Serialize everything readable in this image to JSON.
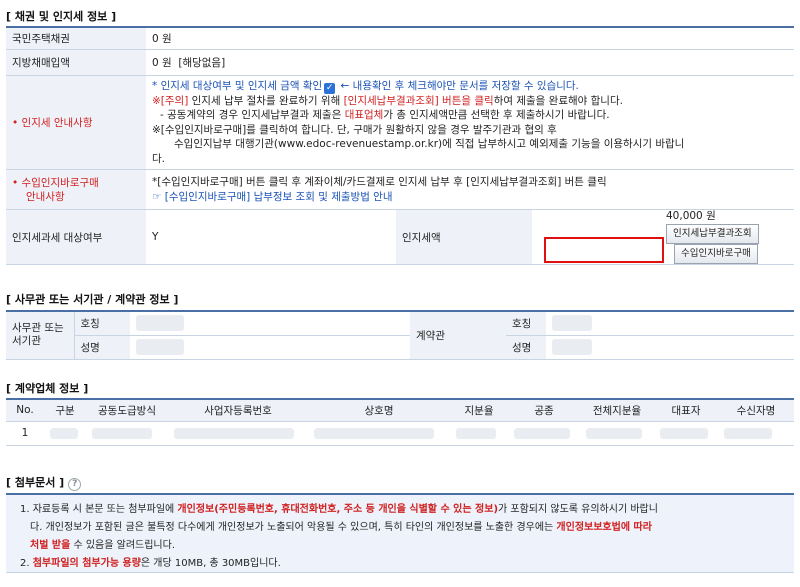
{
  "sections": {
    "bond": "[ 채권 및 인지세 정보 ]",
    "office": "[ 사무관 또는 서기관 / 계약관 정보 ]",
    "contractor": "[ 계약업체 정보 ]",
    "attach": "[ 첨부문서 ]"
  },
  "bond": {
    "national_label": "국민주택채권",
    "national_value": "0 원",
    "local_label": "지방채매입액",
    "local_value": "0 원  [해당없음]",
    "stamp_notice_label": "인지세 안내사항",
    "notice_line1_a": "* 인지세 대상여부 및 인지세 금액 확인",
    "notice_line1_b": "← 내용확인 후 체크해야만 문서를 저장할 수 있습니다.",
    "notice_line2_a": "※[주의]",
    "notice_line2_b": " 인지세 납부 절차를 완료하기 위해 ",
    "notice_line2_c": "[인지세납부결과조회] 버튼을 클릭",
    "notice_line2_d": "하여 제출을 완료해야 합니다.",
    "notice_line3_a": "- 공동계약의 경우 인지세납부결과 제출은 ",
    "notice_line3_b": "대표업체",
    "notice_line3_c": "가 총 인지세액만큼 선택한 후 제출하시기 바랍니다.",
    "notice_line4": "※[수입인지바로구매]를 클릭하여 합니다. 단, 구매가 원활하지 않을 경우 발주기관과 협의 후",
    "notice_line5": "수입인지납부 대행기관(www.edoc-revenuestamp.or.kr)에 직접 납부하시고 예외제출 기능을 이용하시기 바랍니",
    "notice_line6": "다.",
    "buy_label_1": "수입인지바로구매",
    "buy_label_2": "안내사항",
    "buy_line1": "*[수입인지바로구매] 버튼 클릭 후 계좌이체/카드결제로 인지세 납부 후 [인지세납부결과조회] 버튼 클릭",
    "buy_line2": "[수입인지바로구매] 납부정보 조회 및 제출방법 안내",
    "taxable_label": "인지세과세 대상여부",
    "taxable_value": "Y",
    "stamp_amount_label": "인지세액",
    "stamp_amount_value": "40,000 원",
    "btn_result": "인지세납부결과조회",
    "btn_buy": "수입인지바로구매"
  },
  "office": {
    "officer_label_1": "사무관 또는",
    "officer_label_2": "서기관",
    "name_label": "호칭",
    "person_label": "성명",
    "contract_officer_label": "계약관"
  },
  "contractor": {
    "headers": [
      "No.",
      "구분",
      "공동도급방식",
      "사업자등록번호",
      "상호명",
      "지분율",
      "공종",
      "전체지분율",
      "대표자",
      "수신자명"
    ],
    "row_no": "1"
  },
  "attach": {
    "line1_a": "1. 자료등록 시 본문 또는 첨부파일에 ",
    "line1_b": "개인정보(주민등록번호, 휴대전화번호, 주소 등 개인을 식별할 수 있는 정보)",
    "line1_c": "가 포함되지 않도록 유의하시기 바랍니",
    "line2_a": "다. 개인정보가 포함된 글은 불특정 다수에게 개인정보가 노출되어 악용될 수 있으며, 특히 타인의 개인정보를 노출한 경우에는 ",
    "line2_b": "개인정보보호법에 따라",
    "line3_a": "처벌 받을",
    "line3_b": " 수 있음을 알려드립니다.",
    "line4_a": "2. ",
    "line4_b": "첨부파일의 첨부가능 용량",
    "line4_c": "은 개당 10MB, 총 30MB입니다."
  }
}
